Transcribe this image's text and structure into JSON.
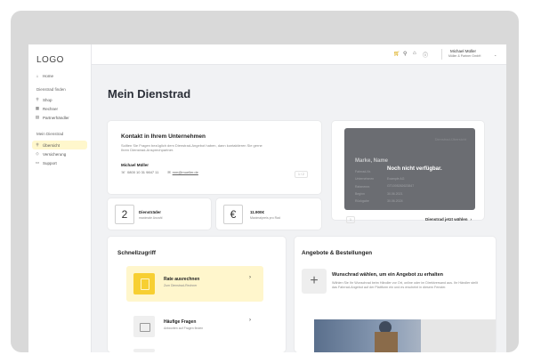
{
  "sidebar": {
    "logo": "LOGO",
    "items_top": [
      {
        "label": "Home",
        "icon": "home-icon"
      }
    ],
    "section1": "Dienstrad finden",
    "items_s1": [
      {
        "label": "Shop",
        "icon": "bike-icon"
      },
      {
        "label": "Rechner",
        "icon": "calculator-icon"
      },
      {
        "label": "Partnerhändler",
        "icon": "store-icon"
      }
    ],
    "section2": "Mein Dienstrad",
    "items_s2": [
      {
        "label": "Übersicht",
        "icon": "bike-icon",
        "active": true
      },
      {
        "label": "Versicherung",
        "icon": "shield-icon"
      },
      {
        "label": "Support",
        "icon": "chat-icon"
      }
    ]
  },
  "topbar": {
    "user_name": "Michael Müller",
    "user_company": "Müller & Partner GmbH"
  },
  "page_title": "Mein Dienstrad",
  "contact": {
    "title": "Kontakt in Ihrem Unternehmen",
    "desc": "Sollten Sie Fragen bezüglich dem Dienstrad-Angebot haben, dann kontaktieren Sie gerne Ihren Dienstrad-Ansprechpartner.",
    "person": "Michael Müller",
    "phone": "0800 10 31 9847 11",
    "email": "mm@mueller.de",
    "pager": "1 / 2"
  },
  "car": {
    "watermark": "Dienstrad-Übersicht",
    "label_title": "Marke, Name",
    "fields": [
      {
        "label": "Fahrrad-Nr.",
        "value": "Noch nicht verfügbar."
      },
      {
        "label": "Unternehmen",
        "value": "Example AG"
      },
      {
        "label": "Rahmennr.",
        "value": "GT1005262623847"
      },
      {
        "label": "Beginn",
        "value": "30.06.2021"
      },
      {
        "label": "Rückgabe",
        "value": "30.06.2024"
      }
    ],
    "pager": "1",
    "cta": "Dienstrad jetzt wählen"
  },
  "stat1": {
    "number": "2",
    "label": "Diensträder",
    "sub": "maximale Anzahl"
  },
  "stat2": {
    "icon_text": "€",
    "value": "11.900€",
    "sub": "Maximalpreis pro Rad"
  },
  "quick": {
    "title": "Schnellzugriff",
    "items": [
      {
        "title": "Rate ausrechnen",
        "sub": "Zum Dienstrad-Rechner"
      },
      {
        "title": "Häufige Fragen",
        "sub": "Antworten auf Fragen finden"
      }
    ]
  },
  "offers": {
    "title": "Angebote & Bestellungen",
    "subtitle": "Wunschrad wählen, um ein Angebot zu erhalten",
    "desc": "Wählen Sie Ihr Wunschrad beim Händler vor Ort, online oder im Direktversand aus. Ihr Händler stellt das Fahrrad-Angebot auf der Plattform ein und es erscheint in diesem Fenster."
  },
  "colors": {
    "accent": "#f7cf32",
    "accent_light": "#fff6cc",
    "dark_card": "#6b6d72"
  }
}
